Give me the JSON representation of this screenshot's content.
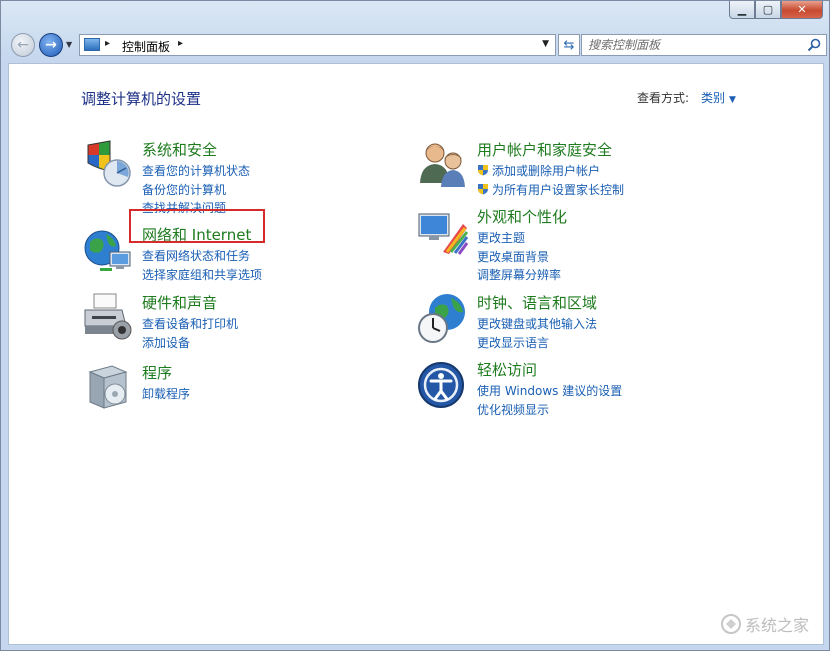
{
  "window": {
    "caption_buttons": {
      "minimize": "▁",
      "maximize": "▢",
      "close": "✕"
    }
  },
  "toolbar": {
    "back_glyph": "←",
    "forward_glyph": "→",
    "history_glyph": "▼",
    "breadcrumb": {
      "root_sep": "▸",
      "location": "控制面板",
      "end_sep": "▸"
    },
    "address_dropdown_glyph": "▼",
    "refresh_glyph": "⇆",
    "search": {
      "placeholder": "搜索控制面板"
    }
  },
  "main": {
    "title": "调整计算机的设置",
    "view_by": {
      "label": "查看方式:",
      "value": "类别",
      "arrow": "▼"
    }
  },
  "categories": {
    "system_security": {
      "title": "系统和安全",
      "links": [
        "查看您的计算机状态",
        "备份您的计算机",
        "查找并解决问题"
      ]
    },
    "network": {
      "title": "网络和 Internet",
      "links": [
        "查看网络状态和任务",
        "选择家庭组和共享选项"
      ]
    },
    "hardware": {
      "title": "硬件和声音",
      "links": [
        "查看设备和打印机",
        "添加设备"
      ]
    },
    "programs": {
      "title": "程序",
      "links": [
        "卸载程序"
      ]
    },
    "user_accounts": {
      "title": "用户帐户和家庭安全",
      "links": [
        "添加或删除用户帐户",
        "为所有用户设置家长控制"
      ]
    },
    "appearance": {
      "title": "外观和个性化",
      "links": [
        "更改主题",
        "更改桌面背景",
        "调整屏幕分辨率"
      ]
    },
    "clock_region": {
      "title": "时钟、语言和区域",
      "links": [
        "更改键盘或其他输入法",
        "更改显示语言"
      ]
    },
    "ease_access": {
      "title": "轻松访问",
      "links": [
        "使用 Windows 建议的设置",
        "优化视频显示"
      ]
    }
  },
  "watermark": {
    "text": "系统之家"
  },
  "colors": {
    "title_blue": "#1e3287",
    "category_green": "#1e7b1e",
    "link_blue": "#1a5fb4",
    "highlight_red": "#d62b2b"
  }
}
